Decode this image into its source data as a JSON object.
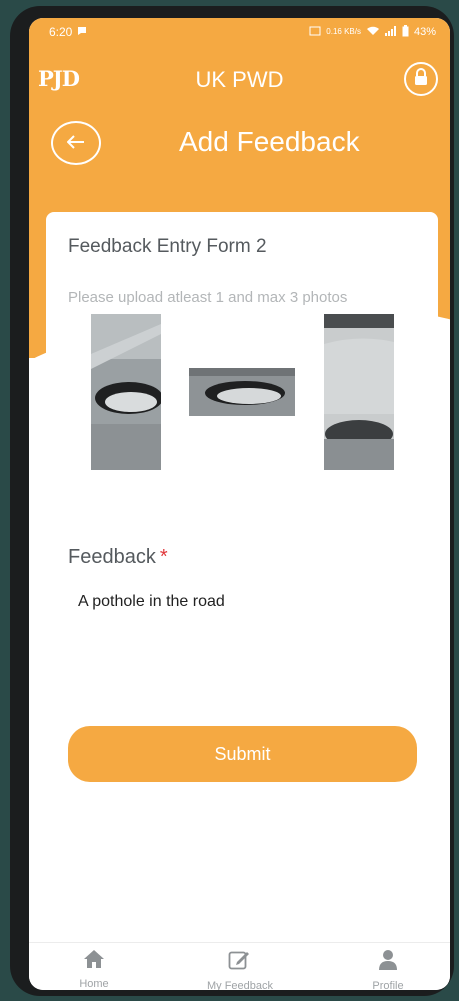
{
  "status_bar": {
    "time": "6:20",
    "network_speed": "0.16\nKB/s",
    "battery": "43%"
  },
  "app": {
    "logo": "PJD",
    "title": "UK PWD"
  },
  "page": {
    "title": "Add Feedback"
  },
  "form": {
    "title": "Feedback Entry Form 2",
    "upload_hint": "Please upload atleast 1 and max 3 photos",
    "feedback_label": "Feedback",
    "required_marker": "*",
    "feedback_value": "A pothole in the road",
    "submit_label": "Submit"
  },
  "bottom_nav": {
    "items": [
      {
        "label": "Home",
        "icon": "home-icon"
      },
      {
        "label": "My Feedback",
        "icon": "edit-icon"
      },
      {
        "label": "Profile",
        "icon": "user-icon"
      }
    ]
  },
  "colors": {
    "accent": "#f5a942",
    "background": "#2a4a48",
    "required": "#e0373b"
  }
}
